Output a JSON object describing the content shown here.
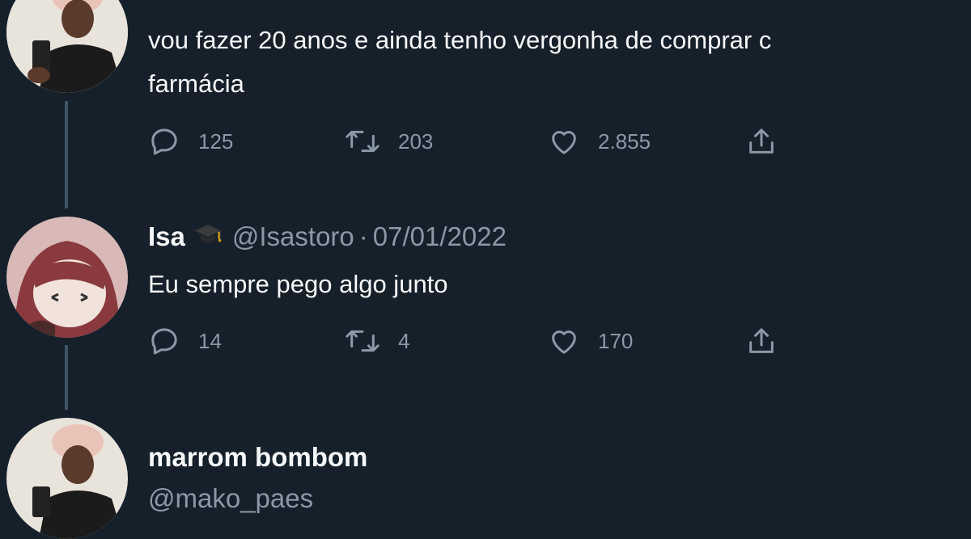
{
  "tweets": [
    {
      "text_line1": "vou fazer 20 anos e ainda tenho vergonha de comprar c",
      "text_line2": "farmácia",
      "replies": "125",
      "retweets": "203",
      "likes": "2.855"
    },
    {
      "name": "Isa",
      "handle": "@Isastoro",
      "separator": "·",
      "date": "07/01/2022",
      "text": "Eu sempre pego algo junto",
      "replies": "14",
      "retweets": "4",
      "likes": "170"
    },
    {
      "name": "marrom bombom",
      "handle": "@mako_paes"
    }
  ],
  "icons": {
    "reply": "reply-icon",
    "retweet": "retweet-icon",
    "like": "heart-icon",
    "share": "share-icon",
    "badge": "graduation-cap-icon"
  },
  "colors": {
    "background": "#15202b",
    "text": "#f7f9f9",
    "muted": "#8b98a5",
    "thread_line": "#3d5466"
  }
}
